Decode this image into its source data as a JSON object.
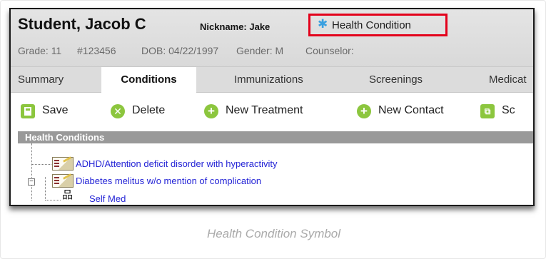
{
  "student": {
    "name": "Student, Jacob C",
    "nickname": "Nickname: Jake",
    "health_badge": "Health Condition",
    "grade": "Grade: 11",
    "id": "#123456",
    "dob": "DOB: 04/22/1997",
    "gender": "Gender: M",
    "counselor": "Counselor:"
  },
  "tabs": [
    {
      "label": "Summary",
      "active": false
    },
    {
      "label": "Conditions",
      "active": true
    },
    {
      "label": "Immunizations",
      "active": false
    },
    {
      "label": "Screenings",
      "active": false
    },
    {
      "label": "Medicat",
      "active": false
    }
  ],
  "toolbar": {
    "save": "Save",
    "delete": "Delete",
    "new_treatment": "New Treatment",
    "new_contact": "New Contact",
    "partial": "Sc"
  },
  "panel": {
    "title": "Health Conditions",
    "rows": [
      "ADHD/Attention deficit disorder with hyperactivity",
      "Diabetes melitus w/o mention of complication",
      "Self Med"
    ]
  },
  "caption": "Health Condition Symbol",
  "colors": {
    "highlight": "#e3001b",
    "icon_green": "#8cc63e",
    "link_blue": "#2424d6",
    "snowflake": "#3aa0e0"
  },
  "icons": {
    "health": "snowflake-icon",
    "save": "save-icon",
    "delete": "x-circle-icon",
    "add": "plus-circle-icon",
    "condition": "condition-document-icon",
    "self_med": "tree-node-icon"
  }
}
